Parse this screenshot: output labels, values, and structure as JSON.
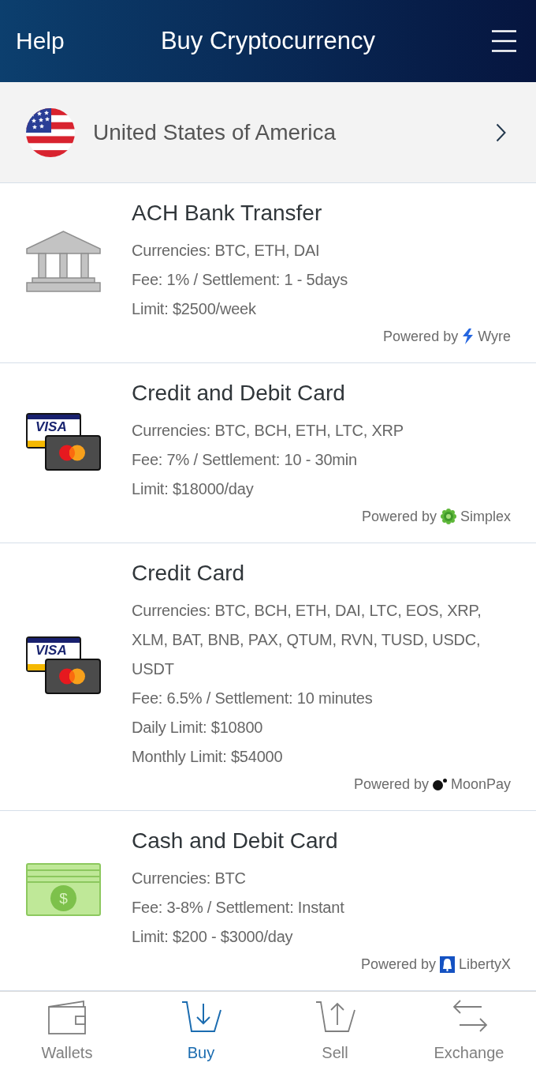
{
  "header": {
    "help_label": "Help",
    "title": "Buy Cryptocurrency"
  },
  "country": {
    "name": "United States of America"
  },
  "methods": [
    {
      "kind": "bank",
      "title": "ACH Bank Transfer",
      "details": [
        "Currencies: BTC, ETH, DAI",
        "Fee: 1% / Settlement: 1 - 5days",
        "Limit: $2500/week"
      ],
      "powered_label": "Powered by",
      "provider": {
        "kind": "bolt",
        "name": "Wyre"
      }
    },
    {
      "kind": "cards",
      "card_text": "VISA",
      "title": "Credit and Debit Card",
      "details": [
        "Currencies: BTC, BCH, ETH, LTC, XRP",
        "Fee: 7% / Settlement: 10 - 30min",
        "Limit: $18000/day"
      ],
      "powered_label": "Powered by",
      "provider": {
        "kind": "gear",
        "name": "Simplex"
      }
    },
    {
      "kind": "cards",
      "card_text": "VISA",
      "title": "Credit Card",
      "details": [
        "Currencies: BTC, BCH, ETH, DAI, LTC, EOS, XRP, XLM, BAT, BNB, PAX, QTUM, RVN, TUSD, USDC, USDT",
        "Fee: 6.5% / Settlement: 10 minutes",
        "Daily Limit: $10800",
        "Monthly Limit: $54000"
      ],
      "powered_label": "Powered by",
      "provider": {
        "kind": "dot",
        "name": "MoonPay"
      }
    },
    {
      "kind": "cash",
      "coin_text": "$",
      "title": "Cash and Debit Card",
      "details": [
        "Currencies: BTC",
        "Fee: 3-8% / Settlement: Instant",
        "Limit: $200 - $3000/day"
      ],
      "powered_label": "Powered by",
      "provider": {
        "kind": "bell",
        "name": "LibertyX"
      }
    }
  ],
  "bottom_nav": [
    {
      "kind": "wallet",
      "label": "Wallets",
      "selected": false
    },
    {
      "kind": "tray-down",
      "label": "Buy",
      "selected": true
    },
    {
      "kind": "tray-up",
      "label": "Sell",
      "selected": false
    },
    {
      "kind": "arrows",
      "label": "Exchange",
      "selected": false
    }
  ]
}
